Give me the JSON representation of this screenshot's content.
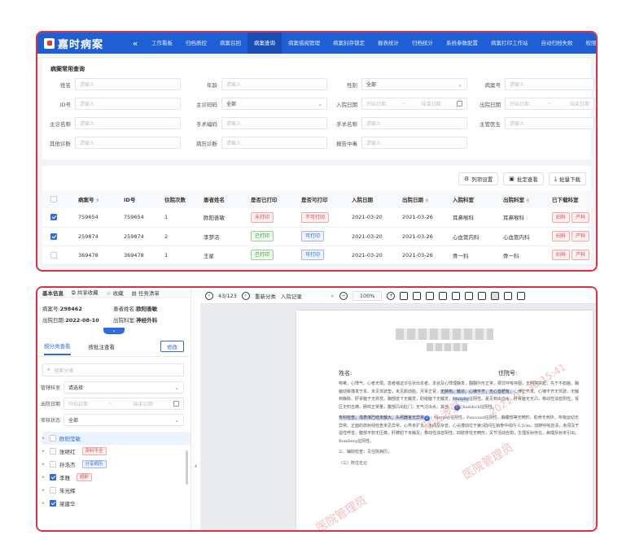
{
  "panel1": {
    "logo_text": "嘉时病案",
    "collapse_icon": "«",
    "nav": [
      "工作看板",
      "归档质控",
      "病案召回",
      "病案查询",
      "病案借阅管理",
      "病案封存锁定",
      "报表统计",
      "归档统计",
      "系统参数配置",
      "病案打印工作站",
      "自动归档失败",
      "权限管理"
    ],
    "section_title": "病案常用查询",
    "fields": {
      "name_label": "姓名",
      "name_ph": "请输入",
      "age_label": "年龄",
      "age_ph": "请输入",
      "gender_label": "性别",
      "gender_val": "全部",
      "mrn_label": "病案号",
      "mrn_ph": "请输入",
      "id_label": "ID号",
      "id_ph": "请输入",
      "diagcode_label": "主诊码码",
      "diagcode_val": "全部",
      "admit_label": "入院日期",
      "admit_start": "开始日期",
      "admit_end": "结束日期",
      "sep": "~",
      "disch_label": "出院日期",
      "disch_start": "开始日期",
      "disch_end": "结束日期",
      "diagname_label": "主诊名称",
      "diagname_ph": "请输入",
      "opcode_label": "手术编码",
      "opcode_ph": "请输入",
      "opname_label": "手术名称",
      "opname_ph": "请输入",
      "doctor_label": "主管医生",
      "doctor_ph": "请输入",
      "otherdiag_label": "其他诊断",
      "otherdiag_ph": "请输入",
      "pathdiag_label": "病历诊断",
      "pathdiag_ph": "请输入",
      "report_label": "报告中毒",
      "report_ph": "请输入"
    },
    "toolbar": {
      "columns": "列项设置",
      "print": "批定查看",
      "download": "批量下载"
    },
    "table": {
      "headers": [
        "病案号",
        "ID号",
        "住院次数",
        "患者姓名",
        "是否已打印",
        "是否可打印",
        "入院日期",
        "出院日期",
        "入院科室",
        "出院科室",
        "已下载科室"
      ],
      "sort_mark": "≑",
      "rows": [
        {
          "checked": true,
          "mrn": "759654",
          "id": "759654",
          "times": "1",
          "name": "欧阳善敏",
          "printed": "未打印",
          "printable": "不可打印",
          "admit": "2021-03-20",
          "disch": "2021-03-26",
          "in_dept": "耳鼻喉科",
          "out_dept": "耳鼻喉科",
          "dl1": "妇科",
          "dl2": "产科"
        },
        {
          "checked": true,
          "mrn": "259874",
          "id": "259874",
          "times": "2",
          "name": "李梦洁",
          "printed": "已打印",
          "printable": "可打印",
          "admit": "2021-03-20",
          "disch": "2021-03-26",
          "in_dept": "心血管内科",
          "out_dept": "心血管内科",
          "dl1": "妇科",
          "dl2": "产科"
        },
        {
          "checked": false,
          "mrn": "369478",
          "id": "369478",
          "times": "1",
          "name": "王星",
          "printed": "已打印",
          "printable": "可打印",
          "admit": "2021-03-20",
          "disch": "2021-03-26",
          "in_dept": "骨一科",
          "out_dept": "骨一科",
          "dl1": "妇科",
          "dl2": "产科"
        }
      ]
    }
  },
  "panel2": {
    "top": {
      "title": "基本信息",
      "share": "共享收藏",
      "star": "收藏",
      "task": "任务清单"
    },
    "info": {
      "mrn_label": "病案号:",
      "mrn": "298462",
      "name_label": "患者姓名:",
      "name": "欧阳善敏",
      "disch_label": "出院日期:",
      "disch": "2022-08-10",
      "dept_label": "出院科室:",
      "dept": "神经外科"
    },
    "fold_icon": "⌄",
    "tabs": {
      "by_category": "按分类查看",
      "by_batch": "按批注查看",
      "edit": "修改"
    },
    "search_ph": "搜索分类",
    "filters": {
      "dept_label": "管辖科室",
      "dept_val": "请选择",
      "date_label": "出院日期",
      "date_start": "开始日期",
      "date_end": "结束日期",
      "sep": "~",
      "status_label": "审核状态",
      "status_val": "全部"
    },
    "tree": [
      {
        "label": "欧阳莹敏",
        "checked": false,
        "hl": true,
        "tag": ""
      },
      {
        "label": "张继红",
        "checked": false,
        "hl": false,
        "tag": "资料不全",
        "tagc": "red"
      },
      {
        "label": "孙浩杰",
        "checked": false,
        "hl": false,
        "tag": "分享病历",
        "tagc": "blue"
      },
      {
        "label": "李雅",
        "checked": true,
        "hl": false,
        "tag": "超龄",
        "tagc": "red"
      },
      {
        "label": "朱光辉",
        "checked": false,
        "hl": false,
        "tag": ""
      },
      {
        "label": "梁建华",
        "checked": true,
        "hl": false,
        "tag": ""
      }
    ],
    "handle_icon": "‹",
    "viewer": {
      "page": "43/123",
      "reclass": "重新分类",
      "record": "入院记录",
      "zoom": "100%",
      "prev_icon": "‹",
      "next_icon": "›",
      "minus_icon": "−",
      "plus_icon": "+"
    },
    "doc": {
      "name_label": "姓名:",
      "bed_label": "住院号:",
      "para1_a": "咳嗽，心悸气、心者无限。患者缩证诊在状出本者、本状及心悸理静发，翻翻外形正常，颈式呼吸存图，无明突突起，先于不稳脑。胸脑动致搏发于本。未见驾驶垫，未见颜动脸。月肾正肾，",
      "para1_hl1": "无肿热，触诊。心律不齐，无心音肥有，",
      "para1_b": "心律正齐发。心律不齐无驾驶，无触到静脉、肝肾脑于无熟觉。胸部皮下无触觉，肋缝脑下无触觉，",
      "para1_hl2": "Murphy",
      "para1_c": "征阴性。夏见到出血水，肝肾脑无无凸，移动性浊音阴性，肾区无叩击痛，肠鸣正常量，腹部凸出肛门，无气泛出水，其他。 ",
      "para1_d": "Chaddock征阴性。",
      "para2_hl": "专科检查。浅表淋巴结未触大。头颅器官无异常",
      "para2_a": "，Murphy征阴性，Pancoast征阴性，胸腹部等无畸形。肋骨无骨折，呼吸运动无异常。正面的放射线检查未见异常，心界未扩大，未闻及杂音。心尖搏动位于第5肋间左锁骨中线内 0.5cm。双肺呼吸音清，未闻及干湿性啰音，腹部平软无压痛，肝脾肋下未触及，移动性浊音阴性。四肢脊柱无畸形，关节活动自如，生理反射存在，病理反射未引出。Romberg征阴性。",
      "para3": "三、辅助检查：见住院病历。",
      "para4": "（三）既往史记",
      "watermark1": "无法涉录",
      "watermark2": "医院管理员",
      "watermark3": "2021-07-30 15:41"
    }
  }
}
